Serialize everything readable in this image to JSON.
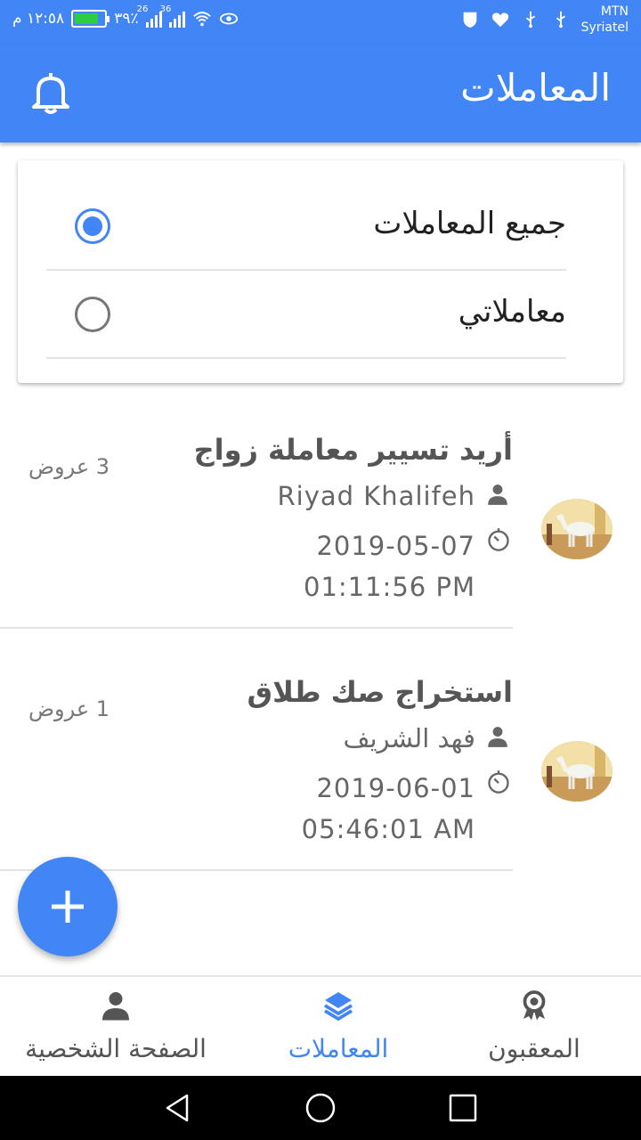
{
  "status_bar": {
    "time": "١٢:٥٨ م",
    "battery": "٣٩٪",
    "signal1_label": "26",
    "signal2_label": "36",
    "carrier_line1": "MTN",
    "carrier_line2": "Syriatel"
  },
  "header": {
    "title": "المعاملات",
    "notification_icon": "bell-icon"
  },
  "filter": {
    "options": [
      {
        "label": "جميع المعاملات",
        "selected": true
      },
      {
        "label": "معاملاتي",
        "selected": false
      }
    ]
  },
  "transactions": [
    {
      "title": "أريد تسيير معاملة زواج",
      "user": "Riyad Khalifeh",
      "datetime": "2019-05-07 01:11:56 PM",
      "offers": "3 عروض"
    },
    {
      "title": "استخراج صك طلاق",
      "user": "فهد الشريف",
      "datetime": "2019-06-01 05:46:01 AM",
      "offers": "1 عروض"
    }
  ],
  "fab": {
    "icon": "plus-icon"
  },
  "bottom_nav": {
    "items": [
      {
        "label": "الصفحة الشخصية",
        "icon": "person-icon",
        "active": false
      },
      {
        "label": "المعاملات",
        "icon": "layers-icon",
        "active": true
      },
      {
        "label": "المعقبون",
        "icon": "award-icon",
        "active": false
      }
    ]
  },
  "colors": {
    "primary": "#4285f4",
    "text_dark": "#222222",
    "text_muted": "#666666"
  }
}
